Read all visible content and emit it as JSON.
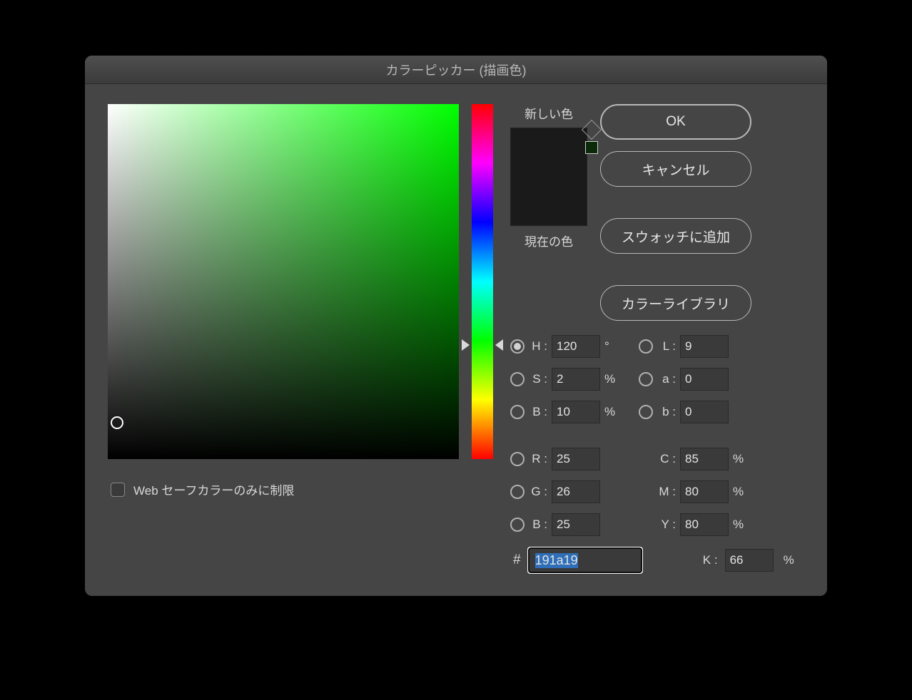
{
  "title": "カラーピッカー (描画色)",
  "labels": {
    "new_color": "新しい色",
    "current_color": "現在の色",
    "web_safe": "Web セーフカラーのみに制限"
  },
  "buttons": {
    "ok": "OK",
    "cancel": "キャンセル",
    "add_swatch": "スウォッチに追加",
    "color_libraries": "カラーライブラリ"
  },
  "fields": {
    "H": {
      "label": "H :",
      "value": "120",
      "unit": "°"
    },
    "S": {
      "label": "S :",
      "value": "2",
      "unit": "%"
    },
    "Bv": {
      "label": "B :",
      "value": "10",
      "unit": "%"
    },
    "R": {
      "label": "R :",
      "value": "25",
      "unit": ""
    },
    "G": {
      "label": "G :",
      "value": "26",
      "unit": ""
    },
    "B": {
      "label": "B :",
      "value": "25",
      "unit": ""
    },
    "L": {
      "label": "L :",
      "value": "9",
      "unit": ""
    },
    "a": {
      "label": "a :",
      "value": "0",
      "unit": ""
    },
    "b": {
      "label": "b :",
      "value": "0",
      "unit": ""
    },
    "C": {
      "label": "C :",
      "value": "85",
      "unit": "%"
    },
    "M": {
      "label": "M :",
      "value": "80",
      "unit": "%"
    },
    "Y": {
      "label": "Y :",
      "value": "80",
      "unit": "%"
    },
    "K": {
      "label": "K :",
      "value": "66",
      "unit": "%"
    }
  },
  "hex": {
    "prefix": "#",
    "value": "191a19"
  },
  "colors": {
    "current": "#191a19",
    "new": "#191a19",
    "hue_deg": 120
  }
}
